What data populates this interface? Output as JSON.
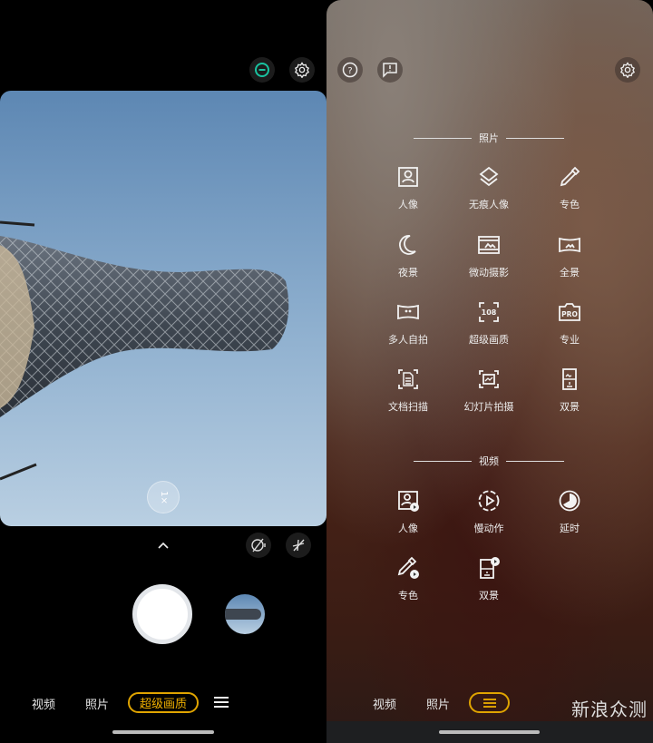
{
  "camera": {
    "zoom_label": "1×",
    "modes": [
      {
        "label": "视频"
      },
      {
        "label": "照片"
      },
      {
        "label": "超级画质",
        "active": true
      }
    ],
    "icons": [
      "no-filter-icon",
      "settings-icon",
      "chevron-up-icon",
      "beauty-off-icon",
      "flash-off-icon",
      "menu-icon"
    ],
    "accent": "#e0a400"
  },
  "mode_menu": {
    "photo_section": "照片",
    "photo_items": [
      {
        "label": "人像",
        "icon": "portrait-icon"
      },
      {
        "label": "无痕人像",
        "icon": "layers-icon"
      },
      {
        "label": "专色",
        "icon": "eyedropper-icon"
      },
      {
        "label": "夜景",
        "icon": "moon-icon"
      },
      {
        "label": "微动摄影",
        "icon": "film-icon"
      },
      {
        "label": "全景",
        "icon": "panorama-icon"
      },
      {
        "label": "多人自拍",
        "icon": "group-selfie-icon"
      },
      {
        "label": "超级画质",
        "icon": "108mp-icon",
        "icon_text": "108"
      },
      {
        "label": "专业",
        "icon": "pro-icon",
        "icon_text": "PRO"
      },
      {
        "label": "文档扫描",
        "icon": "document-scan-icon"
      },
      {
        "label": "幻灯片拍摄",
        "icon": "slide-icon"
      },
      {
        "label": "双景",
        "icon": "dual-view-icon"
      }
    ],
    "video_section": "视频",
    "video_items": [
      {
        "label": "人像",
        "icon": "portrait-video-icon"
      },
      {
        "label": "慢动作",
        "icon": "slow-motion-icon"
      },
      {
        "label": "延时",
        "icon": "timelapse-icon"
      },
      {
        "label": "专色",
        "icon": "eyedropper-video-icon"
      },
      {
        "label": "双景",
        "icon": "dual-view-video-icon"
      }
    ],
    "modes": [
      {
        "label": "视频"
      },
      {
        "label": "照片"
      }
    ],
    "icons": [
      "help-icon",
      "feedback-icon",
      "settings-icon"
    ]
  },
  "watermark": "新浪众测"
}
